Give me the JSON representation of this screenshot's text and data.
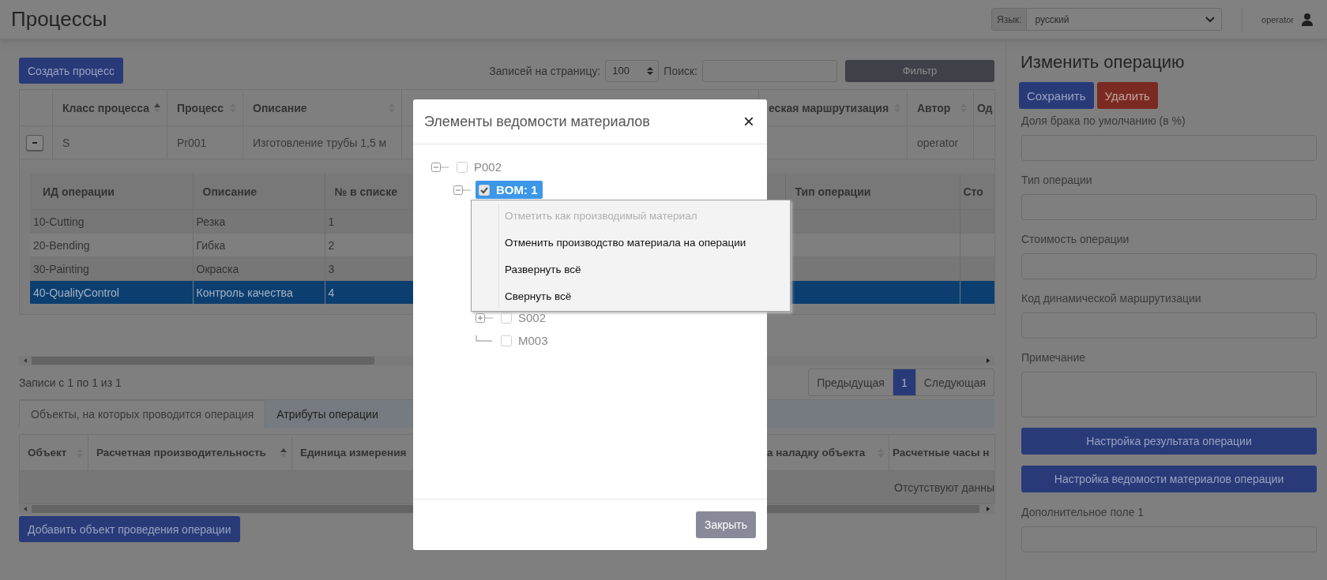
{
  "header": {
    "title": "Процессы",
    "language": {
      "label": "Язык:",
      "value": "русский"
    },
    "user": "operator"
  },
  "toolbar": {
    "create_button": "Создать процесс",
    "page_size_label": "Записей на страницу:",
    "page_size": "100",
    "search_label": "Поиск:",
    "filter_button": "Фильтр"
  },
  "process_table": {
    "columns": [
      {
        "label": "Класс процесса",
        "sorted": true
      },
      {
        "label": "Процесс",
        "sorted": false
      },
      {
        "label": "Описание",
        "sorted": false
      },
      {
        "label": "еская маршрутизация",
        "sorted": false
      },
      {
        "label": "Автор",
        "sorted": false
      },
      {
        "label": "Од"
      }
    ],
    "rows": [
      {
        "expanded": true,
        "class": "S",
        "process": "Pr001",
        "description": "Изготовление трубы 1,5 м",
        "author": "operator",
        "operations": {
          "columns": [
            "ИД операции",
            "Описание",
            "№ в списке",
            "Тип операции",
            "Сто"
          ],
          "rows": [
            {
              "cells": [
                "10-Cutting",
                "Резка",
                "1"
              ],
              "selected": false
            },
            {
              "cells": [
                "20-Bending",
                "Гибка",
                "2"
              ],
              "selected": false
            },
            {
              "cells": [
                "30-Painting",
                "Окраска",
                "3"
              ],
              "selected": false
            },
            {
              "cells": [
                "40-QualityControl",
                "Контроль качества",
                "4"
              ],
              "selected": true
            }
          ]
        }
      }
    ]
  },
  "records_info": "Записи с 1 по 1 из 1",
  "pagination": {
    "previous": "Предыдущая",
    "pages": [
      {
        "label": "1",
        "selected": true
      }
    ],
    "next": "Следующая"
  },
  "tabs": [
    {
      "label": "Объекты, на которых проводится операция",
      "selected": true
    },
    {
      "label": "Атрибуты операции",
      "selected": false
    }
  ],
  "objects_table": {
    "columns": [
      {
        "label": "Объект",
        "sorted": false
      },
      {
        "label": "Расчетная производительность",
        "sorted": true
      },
      {
        "label": "Единица измерения"
      },
      {
        "label": "а наладку объекта",
        "sorted": false
      },
      {
        "label": "Расчетные часы н"
      }
    ],
    "empty_message": "Отсутствуют данны"
  },
  "add_object_button": "Добавить объект проведения операции",
  "edit_panel": {
    "title": "Изменить операцию",
    "save_button": "Сохранить",
    "delete_button": "Удалить",
    "items": [
      {
        "kind": "input",
        "label": "Доля брака по умолчанию (в %)"
      },
      {
        "kind": "input",
        "label": "Тип операции"
      },
      {
        "kind": "input",
        "label": "Стоимость операции"
      },
      {
        "kind": "input",
        "label": "Код динамической маршрутизации"
      },
      {
        "kind": "textarea",
        "label": "Примечание"
      },
      {
        "kind": "button",
        "label": "Настройка результата операции"
      },
      {
        "kind": "button",
        "label": "Настройка ведомости материалов операции"
      },
      {
        "kind": "input",
        "label": "Дополнительное поле 1"
      }
    ]
  },
  "modal": {
    "title": "Элементы ведомости материалов",
    "close": "×",
    "tree": [
      {
        "label": "P002",
        "checked": false,
        "expanded": true,
        "selected": false,
        "children": [
          {
            "label": "BOM: 1",
            "checked": true,
            "expanded": true,
            "selected": true,
            "children": [
              {
                "label": "S002",
                "checked": false,
                "expanded": false,
                "selected": false
              },
              {
                "label": "M003",
                "checked": false,
                "selected": false
              }
            ]
          }
        ]
      }
    ],
    "context_menu": [
      {
        "label": "Отметить как производимый материал",
        "disabled": true
      },
      {
        "label": "Отменить производство материала на операции",
        "disabled": false
      },
      {
        "label": "Развернуть всё",
        "disabled": false
      },
      {
        "label": "Свернуть всё",
        "disabled": false
      }
    ],
    "close_button": "Закрыть"
  }
}
